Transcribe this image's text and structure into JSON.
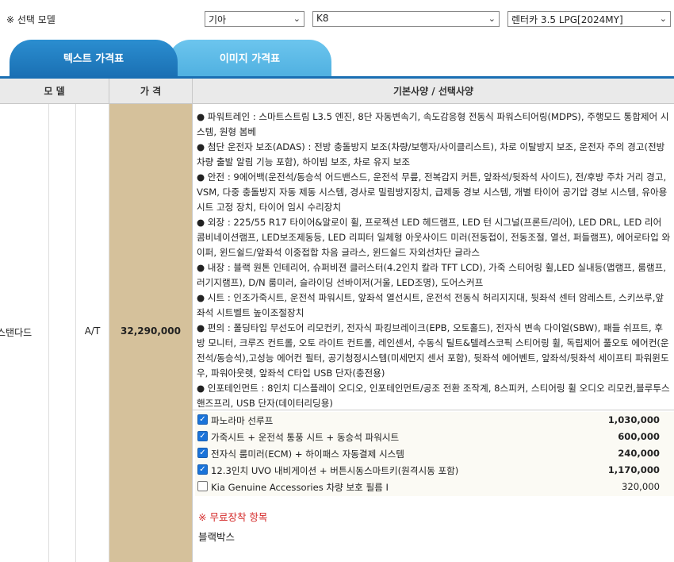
{
  "selector": {
    "label": "※ 선택 모델",
    "brand": "기아",
    "model": "K8",
    "trim": "렌터카 3.5 LPG[2024MY]"
  },
  "tabs": [
    {
      "label": "텍스트 가격표",
      "active": true
    },
    {
      "label": "이미지 가격표",
      "active": false
    }
  ],
  "table": {
    "headers": {
      "model": "모 델",
      "price": "가 격",
      "spec": "기본사양 / 선택사양"
    },
    "row": {
      "trim": "스탠다드",
      "transmission": "A/T",
      "price": "32,290,000"
    },
    "spec_lines": [
      "● 파워트레인 : 스마트스트림 L3.5 엔진, 8단 자동변속기, 속도감응형 전동식 파워스티어링(MDPS), 주행모드 통합제어 시스템, 원형 봄베",
      "● 첨단 운전자 보조(ADAS) : 전방 충돌방지 보조(차량/보행자/사이클리스트), 차로 이탈방지 보조, 운전자 주의 경고(전방 차량 출발 알림 기능 포함), 하이빔 보조, 차로 유지 보조",
      "● 안전 : 9에어백(운전석/동승석 어드밴스드, 운전석 무릎, 전복감지 커튼, 앞좌석/뒷좌석 사이드), 전/후방 주차 거리 경고, VSM, 다중 충돌방지 자동 제동 시스템, 경사로 밀림방지장치, 급제동 경보 시스템, 개별 타이어 공기압 경보 시스템, 유아용 시트 고정 장치, 타이어 임시 수리장치",
      "● 외장 : 225/55 R17 타이어&알로이 휠, 프로젝션 LED 헤드램프, LED 턴 시그널(프론트/리어), LED DRL, LED 리어 콤비네이션램프, LED보조제동등, LED 리피터 일체형 아웃사이드 미러(전동접이, 전동조절, 열선, 퍼들램프), 에어로타입 와이퍼, 윈드쉴드/앞좌석 이중접합 차음 글라스, 윈드쉴드 자외선차단 글라스",
      "● 내장 : 블랙 원톤 인테리어, 슈퍼비젼 클러스터(4.2인치 칼라 TFT LCD), 가죽 스티어링 휠,LED 실내등(맵램프, 룸램프, 러기지램프), D/N 룸미러, 슬라이딩 선바이저(거울, LED조명), 도어스커프",
      "● 시트 : 인조가죽시트, 운전석 파워시트, 앞좌석 열선시트, 운전석 전동식 허리지지대, 뒷좌석 센터 암레스트, 스키쓰루,앞좌석 시트벨트 높이조절장치",
      "● 편의 : 폴딩타입 무선도어 리모컨키, 전자식 파킹브레이크(EPB, 오토홀드), 전자식 변속 다이얼(SBW), 패들 쉬프트, 후방 모니터, 크루즈 컨트롤, 오토 라이트 컨트롤, 레인센서, 수동식 틸트&텔레스코픽 스티어링 휠, 독립제어 풀오토 에어컨(운전석/동승석),고성능 에어컨 필터, 공기청정시스템(미세먼지 센서 포함), 뒷좌석 에어벤트, 앞좌석/뒷좌석 세이프티 파워윈도우, 파워아웃렛, 앞좌석 C타입 USB 단자(충전용)",
      "● 인포테인먼트 : 8인치 디스플레이 오디오, 인포테인먼트/공조 전환 조작계, 8스피커, 스티어링 휠 오디오 리모컨,블루투스 핸즈프리, USB 단자(데이터리딩용)"
    ],
    "options": [
      {
        "name": "파노라마 선루프",
        "price": "1,030,000",
        "checked": true
      },
      {
        "name": "가죽시트 + 운전석 통풍 시트 + 동승석 파워시트",
        "price": "600,000",
        "checked": true
      },
      {
        "name": "전자식 룸미러(ECM) + 하이패스 자동결제 시스템",
        "price": "240,000",
        "checked": true
      },
      {
        "name": "12.3인치 UVO 내비게이션 + 버튼시동스마트키(원격시동 포함)",
        "price": "1,170,000",
        "checked": true
      },
      {
        "name": "Kia Genuine Accessories 차량 보호 필름 I",
        "price": "320,000",
        "checked": false
      }
    ],
    "free_install": {
      "title": "※ 무료장착 항목",
      "item": "블랙박스"
    }
  },
  "colors": {
    "tab_active": "#1a6fb3",
    "tab_inactive": "#4fb0e0",
    "price_bg": "#d5c19b",
    "header_bg": "#eaeaea",
    "checkbox": "#1a73d9",
    "free_title": "#d42a2a"
  }
}
